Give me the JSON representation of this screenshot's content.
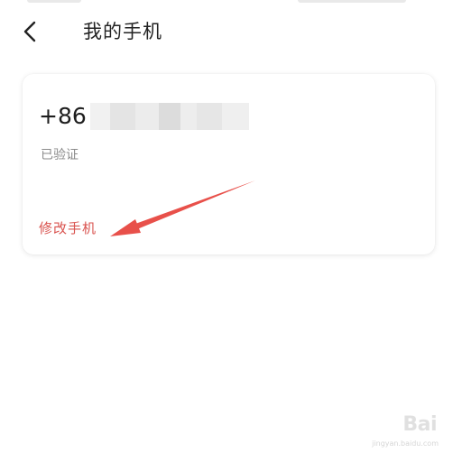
{
  "header": {
    "back_icon": "chevron-left-icon",
    "title": "我的手机"
  },
  "card": {
    "phone_prefix": "+86",
    "status": "已验证",
    "modify_link": "修改手机"
  },
  "colors": {
    "accent_red": "#d9534f",
    "title_text": "#222222",
    "muted_text": "#8a8a8a"
  },
  "watermark": {
    "logo": "Bai",
    "caption": "jingyan.baidu.com"
  }
}
